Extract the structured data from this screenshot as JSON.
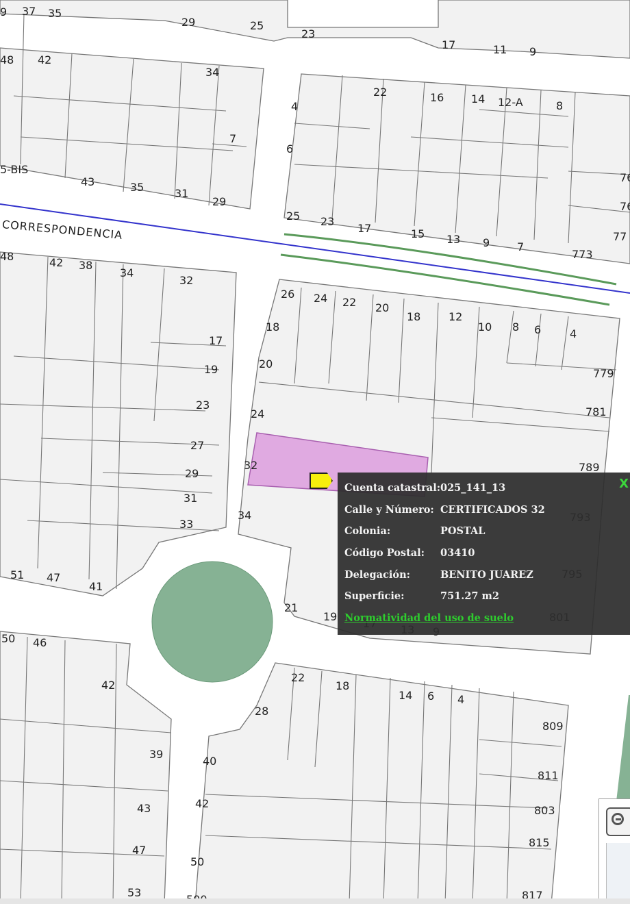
{
  "map": {
    "street_name": "CORRESPONDENCIA",
    "lot_numbers": [
      "9",
      "37",
      "35",
      "29",
      "25",
      "23",
      "17",
      "11",
      "9",
      "48",
      "42",
      "34",
      "22",
      "16",
      "14",
      "12-A",
      "8",
      "4",
      "7",
      "6",
      "5-BIS",
      "43",
      "35",
      "31",
      "29",
      "76",
      "76",
      "77",
      "25",
      "23",
      "17",
      "15",
      "13",
      "9",
      "7",
      "773",
      "48",
      "42",
      "38",
      "34",
      "32",
      "26",
      "24",
      "22",
      "20",
      "18",
      "12",
      "10",
      "8",
      "6",
      "4",
      "17",
      "18",
      "19",
      "20",
      "779",
      "23",
      "24",
      "781",
      "27",
      "32",
      "789",
      "29",
      "31",
      "34",
      "793",
      "33",
      "51",
      "47",
      "41",
      "795",
      "21",
      "19",
      "17",
      "13",
      "9",
      "801",
      "50",
      "46",
      "42",
      "22",
      "18",
      "14",
      "6",
      "4",
      "28",
      "809",
      "39",
      "40",
      "811",
      "43",
      "42",
      "803",
      "47",
      "50",
      "815",
      "53",
      "500",
      "817"
    ]
  },
  "popup": {
    "rows": [
      {
        "label": "Cuenta catastral:",
        "value": "025_141_13"
      },
      {
        "label": "Calle y Número:",
        "value": "CERTIFICADOS 32"
      },
      {
        "label": "Colonia:",
        "value": "POSTAL"
      },
      {
        "label": "Código Postal:",
        "value": "03410"
      },
      {
        "label": "Delegación:",
        "value": "BENITO JUAREZ"
      },
      {
        "label": "Superficie:",
        "value": "751.27 m2"
      }
    ],
    "link": "Normatividad del uso de suelo",
    "close": "X"
  },
  "colors": {
    "highlight_lot": "#dfa3e0",
    "park": "#86b294",
    "street_line": "#3333cc",
    "rail_line": "#5a9a5a",
    "popup_bg": "#2d2d2d",
    "link": "#2ecc2e",
    "marker": "#f7ef0d"
  },
  "icons": {
    "zoom": "zoom-out-icon",
    "marker": "location-marker-icon",
    "close": "close-icon"
  }
}
